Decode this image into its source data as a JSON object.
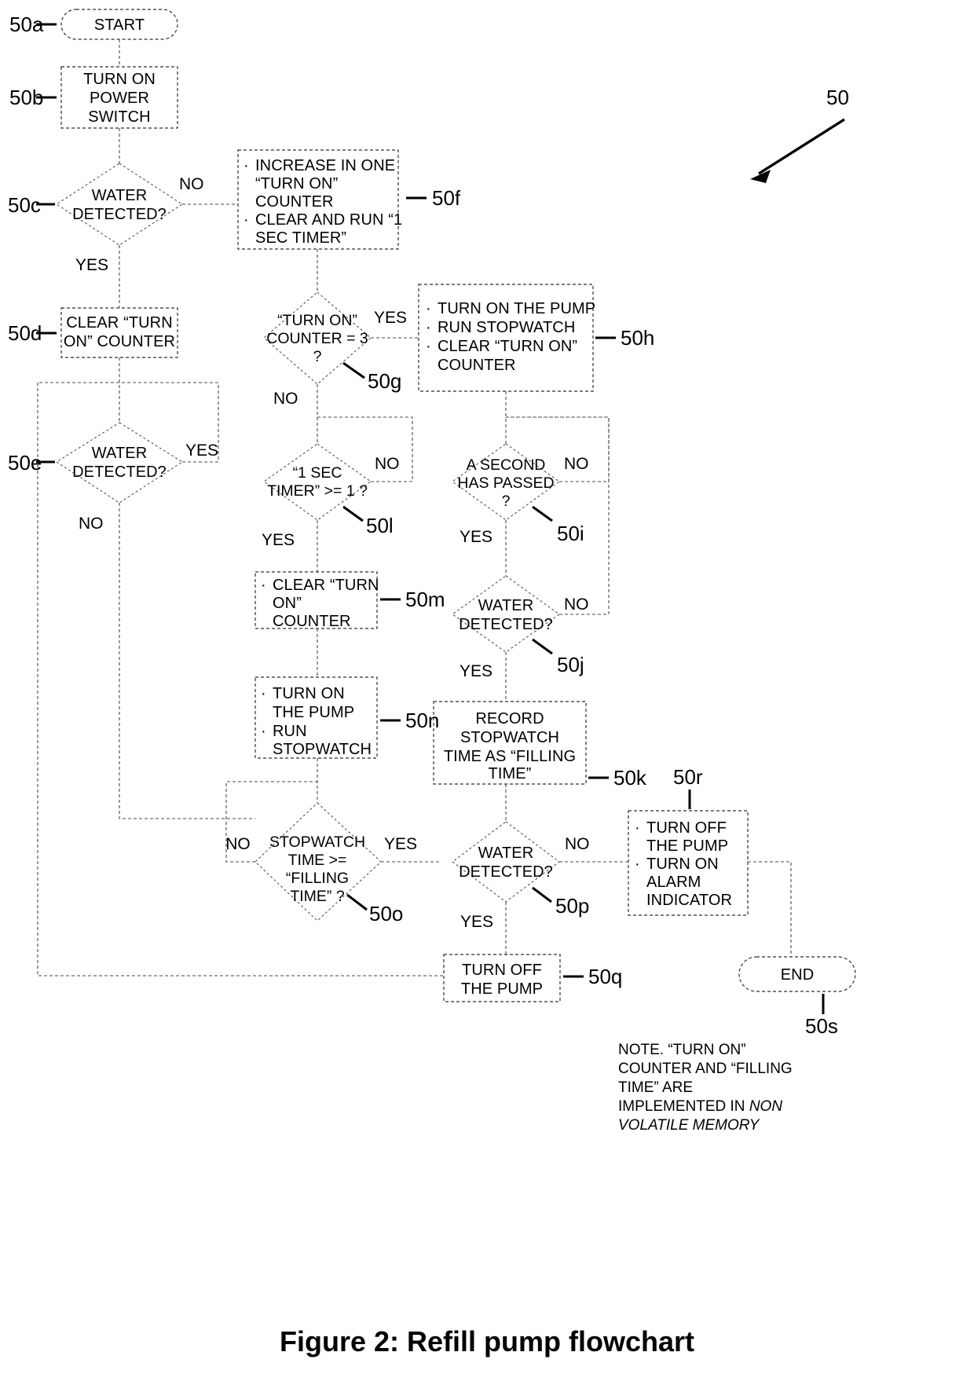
{
  "figure": {
    "caption": "Figure 2:  Refill pump flowchart",
    "overall_ref": "50"
  },
  "nodes": {
    "start": {
      "ref": "50a",
      "label": "START",
      "type": "terminator"
    },
    "power": {
      "ref": "50b",
      "type": "process",
      "lines": [
        "TURN ON",
        "POWER",
        "SWITCH"
      ]
    },
    "water1": {
      "ref": "50c",
      "type": "decision",
      "lines": [
        "WATER",
        "DETECTED?"
      ],
      "yes": "YES",
      "no": "NO"
    },
    "clear_counter": {
      "ref": "50d",
      "type": "process",
      "lines": [
        "CLEAR “TURN",
        "ON” COUNTER"
      ]
    },
    "water2": {
      "ref": "50e",
      "type": "decision",
      "lines": [
        "WATER",
        "DETECTED?"
      ],
      "yes": "YES",
      "no": "NO"
    },
    "increase": {
      "ref": "50f",
      "type": "process-bullets",
      "bullets": [
        [
          "INCREASE IN ONE",
          "“TURN ON”",
          "COUNTER"
        ],
        [
          "CLEAR AND RUN “1",
          "SEC TIMER”"
        ]
      ]
    },
    "counter3": {
      "ref": "50g",
      "type": "decision",
      "lines": [
        "“TURN ON”",
        "COUNTER = 3",
        "?"
      ],
      "yes": "YES",
      "no": "NO"
    },
    "pump_on1": {
      "ref": "50h",
      "type": "process-bullets",
      "bullets": [
        [
          "TURN ON THE PUMP"
        ],
        [
          "RUN STOPWATCH"
        ],
        [
          "CLEAR “TURN ON”",
          "COUNTER"
        ]
      ]
    },
    "second_passed": {
      "ref": "50i",
      "type": "decision",
      "lines": [
        "A SECOND",
        "HAS PASSED",
        "?"
      ],
      "yes": "YES",
      "no": "NO"
    },
    "water3": {
      "ref": "50j",
      "type": "decision",
      "lines": [
        "WATER",
        "DETECTED?"
      ],
      "yes": "YES",
      "no": "NO"
    },
    "record": {
      "ref": "50k",
      "type": "process",
      "lines": [
        "RECORD",
        "STOPWATCH",
        "TIME AS “FILLING",
        "TIME”"
      ]
    },
    "timer1": {
      "ref": "50l",
      "type": "decision",
      "lines": [
        "“1 SEC",
        "TIMER” >= 1 ?"
      ],
      "yes": "YES",
      "no": "NO"
    },
    "clear_counter2": {
      "ref": "50m",
      "type": "process-bullets",
      "bullets": [
        [
          "CLEAR “TURN",
          "ON”",
          "COUNTER"
        ]
      ]
    },
    "pump_on2": {
      "ref": "50n",
      "type": "process-bullets",
      "bullets": [
        [
          "TURN ON",
          "THE PUMP"
        ],
        [
          "RUN",
          "STOPWATCH"
        ]
      ]
    },
    "stopwatch_cmp": {
      "ref": "50o",
      "type": "decision",
      "lines": [
        "STOPWATCH",
        "TIME >=",
        "“FILLING",
        "TIME” ?"
      ],
      "yes": "YES",
      "no": "NO"
    },
    "water4": {
      "ref": "50p",
      "type": "decision",
      "lines": [
        "WATER",
        "DETECTED?"
      ],
      "yes": "YES",
      "no": "NO"
    },
    "turn_off_pump": {
      "ref": "50q",
      "type": "process",
      "lines": [
        "TURN OFF",
        "THE PUMP"
      ]
    },
    "alarm": {
      "ref": "50r",
      "type": "process-bullets",
      "bullets": [
        [
          "TURN OFF",
          "THE PUMP"
        ],
        [
          "TURN ON",
          "ALARM",
          "INDICATOR"
        ]
      ]
    },
    "end": {
      "ref": "50s",
      "label": "END",
      "type": "terminator"
    }
  },
  "note": {
    "lines": [
      "NOTE. “TURN ON”",
      "COUNTER AND “FILLING",
      "TIME” ARE"
    ],
    "line4_plain": "IMPLEMENTED IN ",
    "line4_italic": "NON",
    "line5_italic": "VOLATILE MEMORY"
  },
  "colors": {
    "ink": "#000000",
    "node_stroke": "#2f2f2f",
    "connector": "#4a4a4a",
    "background": "#ffffff"
  }
}
